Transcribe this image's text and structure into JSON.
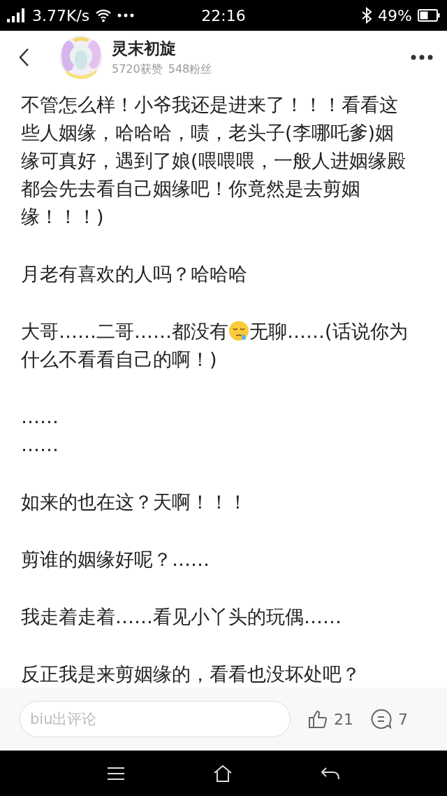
{
  "status_bar": {
    "speed": "3.77K/s",
    "time": "22:16",
    "battery": "49%"
  },
  "header": {
    "name": "灵末初旋",
    "likes": "5720获赞",
    "fans": "548粉丝"
  },
  "paragraphs": [
    {
      "segments": [
        "不管怎么样！小爷我还是进来了！！！看看这些人姻缘，哈哈哈，啧，老头子(李哪吒爹)姻缘可真好，遇到了娘(喂喂喂，一般人进姻缘殿都会先去看自己姻缘吧！你竟然是去剪姻缘！！！)"
      ]
    },
    {
      "segments": [
        "月老有喜欢的人吗？哈哈哈"
      ]
    },
    {
      "segments": [
        "大哥……二哥……都没有",
        {
          "kind": "emoji"
        },
        "无聊……(话说你为",
        "什么不看看自己的啊！)"
      ]
    },
    {
      "segments": [
        "……\n……"
      ]
    },
    {
      "segments": [
        "如来的也在这？天啊！！！"
      ]
    },
    {
      "segments": [
        "剪谁的姻缘好呢？……"
      ]
    },
    {
      "segments": [
        "我走着走着……看见小丫头的玩偶……"
      ]
    },
    {
      "segments": [
        "反正我是来剪姻缘的，看看也没坏处吧？"
      ]
    }
  ],
  "comment_bar": {
    "placeholder": "biu出评论",
    "likes": "21",
    "comments": "7"
  }
}
